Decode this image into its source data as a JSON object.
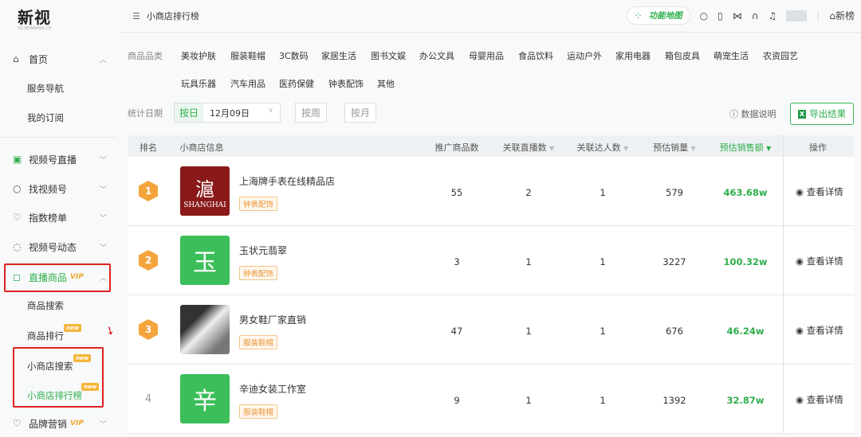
{
  "logo": {
    "name": "新视",
    "sub": "XS.NEWRANK.CN"
  },
  "header": {
    "breadcrumb": "小商店排行榜",
    "function_map": "功能地图",
    "home_link": "新榜"
  },
  "sidebar": {
    "home": "首页",
    "service_nav": "服务导航",
    "my_sub": "我的订阅",
    "items": [
      {
        "label": "视频号直播"
      },
      {
        "label": "找视频号"
      },
      {
        "label": "指数榜单"
      },
      {
        "label": "视频号动态"
      }
    ],
    "live_goods": {
      "label": "直播商品",
      "vip": "VIP"
    },
    "sub_items": [
      {
        "label": "商品搜索"
      },
      {
        "label": "商品排行",
        "badge": "new"
      },
      {
        "label": "小商店搜索",
        "badge": "new"
      },
      {
        "label": "小商店排行榜",
        "badge": "new"
      }
    ],
    "brand": {
      "label": "品牌营销",
      "vip": "VIP"
    }
  },
  "filters": {
    "category_label": "商品品类",
    "categories": [
      "美妆护肤",
      "服装鞋帽",
      "3C数码",
      "家居生活",
      "图书文娱",
      "办公文具",
      "母婴用品",
      "食品饮料",
      "运动户外",
      "家用电器",
      "箱包皮具",
      "萌宠生活",
      "农资园艺",
      "玩具乐器",
      "汽车用品",
      "医药保健",
      "钟表配饰",
      "其他"
    ],
    "date_label": "统计日期",
    "by_day": "按日",
    "date_value": "12月09日",
    "by_week": "按周",
    "by_month": "按月",
    "data_info": "数据说明",
    "export": "导出结果"
  },
  "table": {
    "headers": [
      "排名",
      "小商店信息",
      "推广商品数",
      "关联直播数",
      "关联达人数",
      "预估销量",
      "预估销售额",
      "操作"
    ],
    "rows": [
      {
        "rank": "1",
        "name": "上海牌手表在线精品店",
        "tag": "钟表配饰",
        "thumb": "SHANGHAI",
        "products": "55",
        "lives": "2",
        "influencers": "1",
        "sales_qty": "579",
        "sales_amt": "463.68w",
        "action": "查看详情"
      },
      {
        "rank": "2",
        "name": "玉状元翡翠",
        "tag": "钟表配饰",
        "thumb": "玉",
        "products": "3",
        "lives": "1",
        "influencers": "1",
        "sales_qty": "3227",
        "sales_amt": "100.32w",
        "action": "查看详情"
      },
      {
        "rank": "3",
        "name": "男女鞋厂家直销",
        "tag": "服装鞋帽",
        "thumb": "",
        "products": "47",
        "lives": "1",
        "influencers": "1",
        "sales_qty": "676",
        "sales_amt": "46.24w",
        "action": "查看详情"
      },
      {
        "rank": "4",
        "name": "辛迪女装工作室",
        "tag": "服装鞋帽",
        "thumb": "辛",
        "products": "9",
        "lives": "1",
        "influencers": "1",
        "sales_qty": "1392",
        "sales_amt": "32.87w",
        "action": "查看详情"
      }
    ]
  }
}
